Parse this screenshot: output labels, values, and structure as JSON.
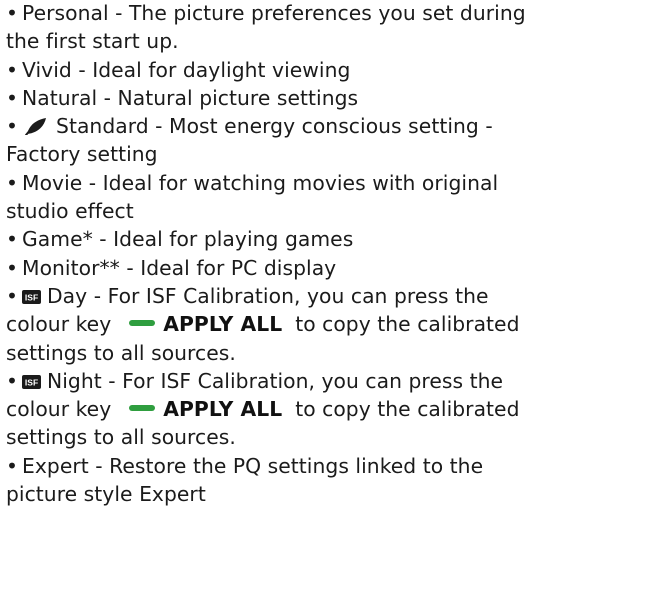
{
  "items": [
    {
      "name": "Personal",
      "line1": "Personal - The picture preferences you set during",
      "line2": "the first start up."
    },
    {
      "name": "Vivid",
      "line1": "Vivid - Ideal for daylight viewing"
    },
    {
      "name": "Natural",
      "line1": "Natural - Natural picture settings"
    },
    {
      "name": "Standard",
      "icon": "eco-leaf-icon",
      "line1": "Standard - Most energy conscious setting -",
      "line2": "Factory setting"
    },
    {
      "name": "Movie",
      "line1": "Movie - Ideal for watching movies with original",
      "line2": "studio effect"
    },
    {
      "name": "Game",
      "line1": "Game* - Ideal for playing games"
    },
    {
      "name": "Monitor",
      "line1": "Monitor** - Ideal for PC display"
    },
    {
      "name": "Day",
      "icon": "isf-icon",
      "line1": "Day - For ISF Calibration, you can press the",
      "line2_prefix": "colour key",
      "key_label": "APPLY ALL",
      "line2_suffix": "to copy the calibrated",
      "line3": "settings to all sources."
    },
    {
      "name": "Night",
      "icon": "isf-icon",
      "line1": "Night - For ISF Calibration, you can press the",
      "line2_prefix": "colour key",
      "key_label": "APPLY ALL",
      "line2_suffix": "to copy the calibrated",
      "line3": "settings to all sources."
    },
    {
      "name": "Expert",
      "line1": "Expert - Restore the PQ settings linked to the",
      "line2": "picture style Expert"
    }
  ],
  "bullet": "•",
  "isf_icon_text": "ISF",
  "colors": {
    "text": "#1b1b1b",
    "green_key": "#2f9e3f",
    "isf_badge": "#1b1b1b"
  }
}
